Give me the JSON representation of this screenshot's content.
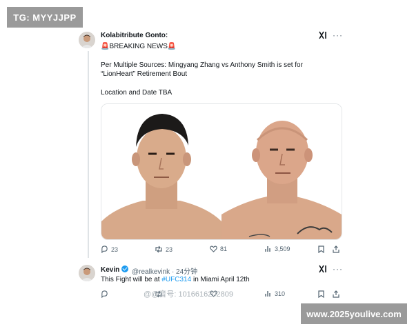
{
  "corner_badges": {
    "top_left": "TG: MYYJJPP",
    "bottom_right": "www.2025youlive.com"
  },
  "tweet1": {
    "display_name": "Kolabitribute Gonto:",
    "headline": "🚨BREAKING NEWS🚨",
    "body_line1": "Per Multiple Sources: Mingyang Zhang vs Anthony Smith is set for",
    "body_line2": "“LionHeart” Retirement Bout",
    "body_line3": "Location and Date TBA",
    "menu_icon": "xai-icon",
    "more_icon": "more-icon",
    "actions": {
      "replies": "23",
      "retweets": "23",
      "likes": "81",
      "views": "3,509"
    }
  },
  "tweet2": {
    "display_name": "Kevin",
    "handle_time": "@realkevink · 24分钟",
    "text_before": "This Fight will be at ",
    "hashtag": "#UFC314",
    "text_after": " in Miami April 12th",
    "actions": {
      "views": "310"
    }
  },
  "watermark": "@@音号: 1016616202809",
  "colors": {
    "accent": "#1d9bf0",
    "text": "#0f1419",
    "muted": "#536471",
    "badge": "#9a9a9a"
  }
}
